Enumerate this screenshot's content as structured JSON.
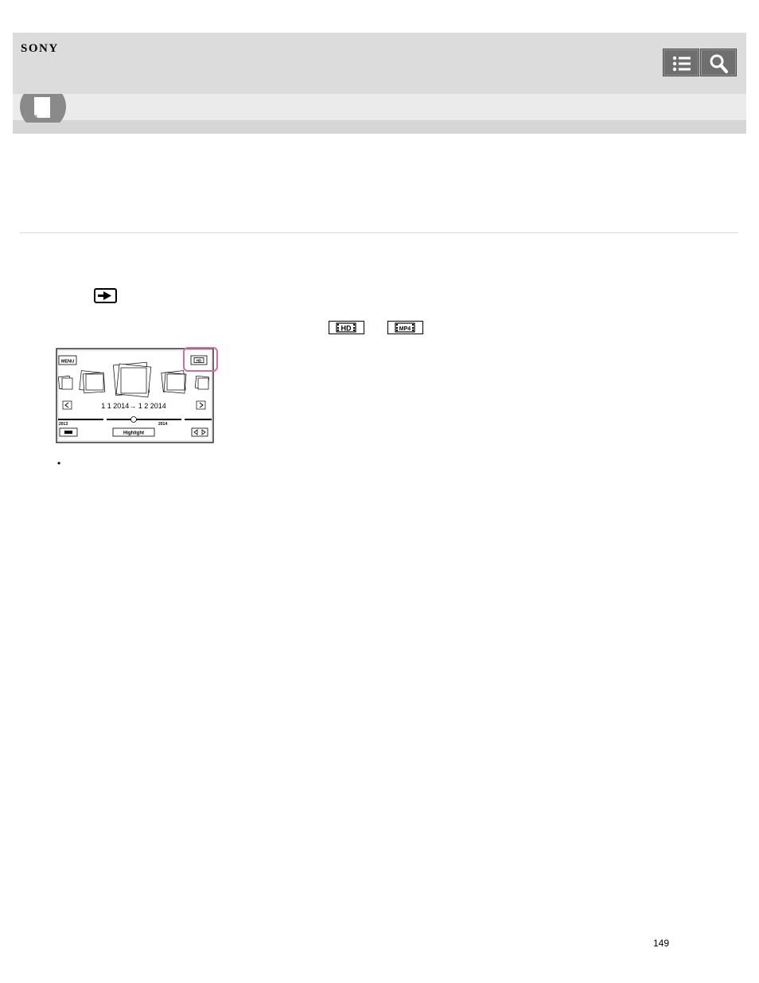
{
  "header": {
    "brand": "SONY",
    "buttons": [
      {
        "name": "contents-list",
        "icon": "list-icon"
      },
      {
        "name": "search",
        "icon": "search-icon"
      }
    ],
    "header_bg": "#dcdcdc",
    "button_bg": "#6f6f6f"
  },
  "section_icon": "book-icon",
  "inline_icons": [
    "play-mode-icon",
    "hd-format-icon",
    "mp4-format-icon"
  ],
  "screen_illustration": {
    "menu_label": "MENU",
    "format_indicator": "HD",
    "date_range": "1 1 2014→ 1 2 2014",
    "timeline_start": "2013",
    "timeline_end": "2014",
    "highlight_label": "Highlight",
    "highlight_color": "#d06ca0"
  },
  "bullet": "•",
  "page_number": "149"
}
